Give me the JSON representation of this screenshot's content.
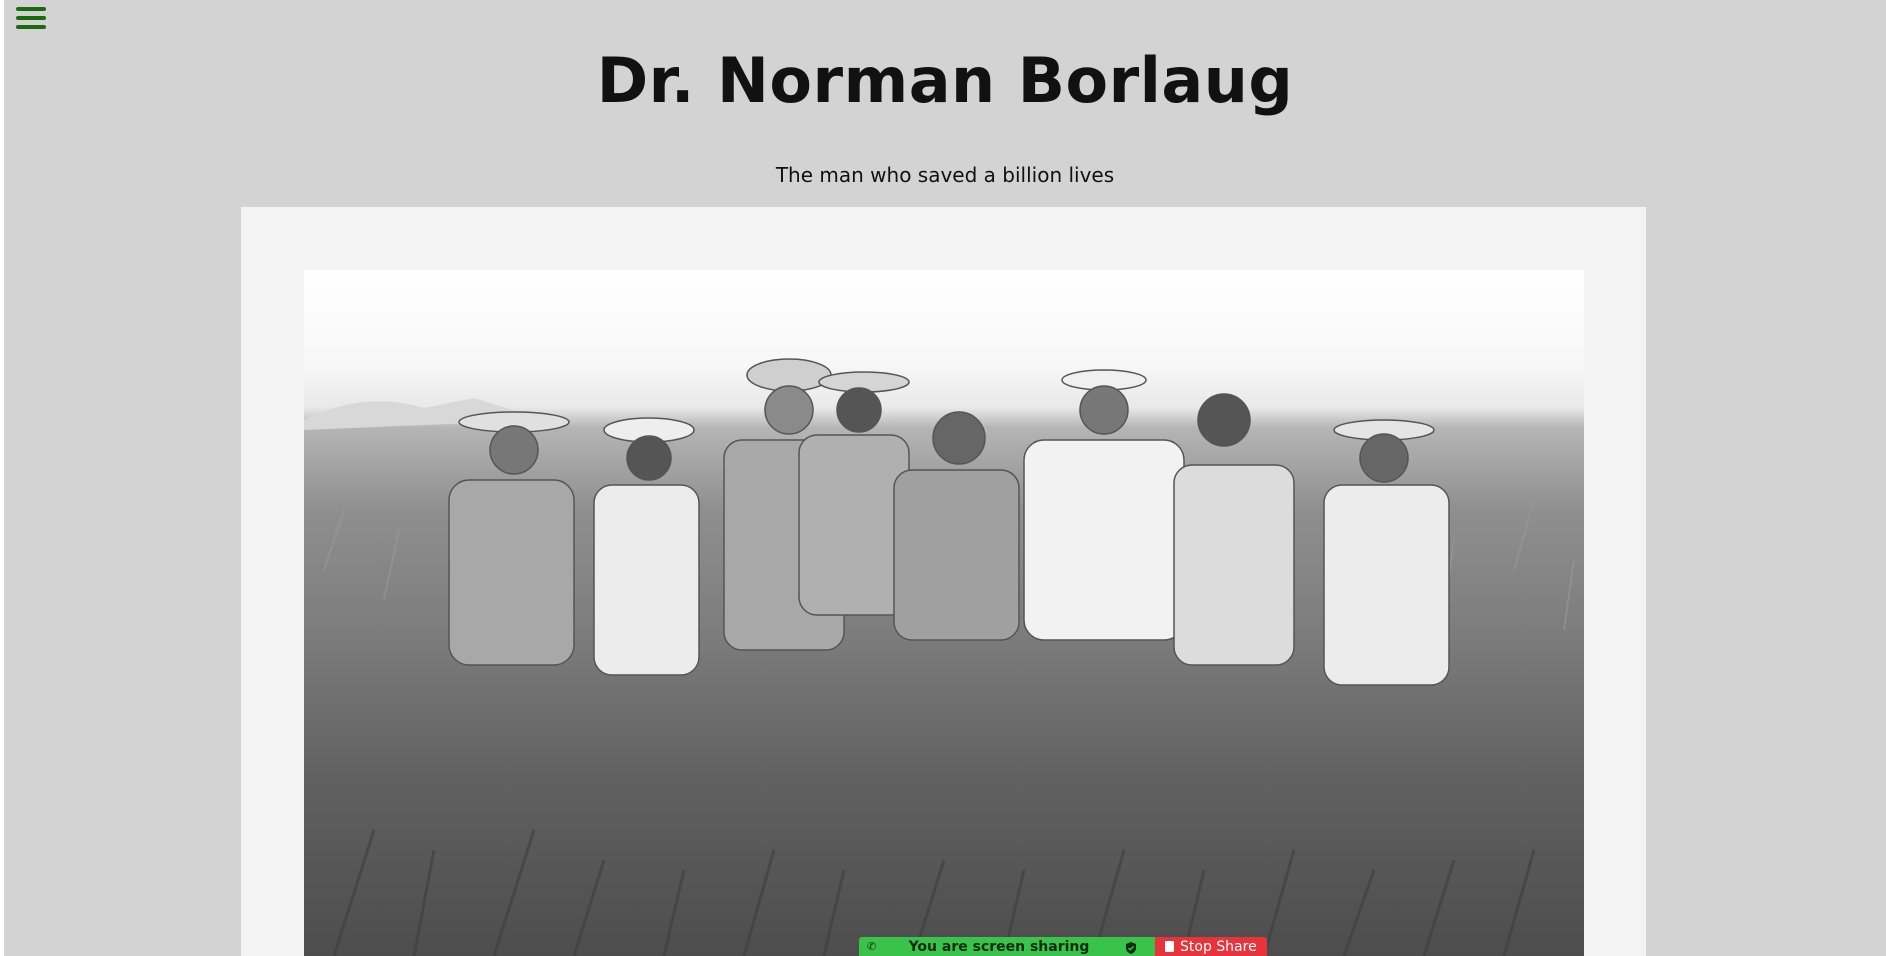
{
  "header": {
    "title": "Dr. Norman Borlaug",
    "subtitle": "The man who saved a billion lives"
  },
  "menu": {
    "icon": "hamburger-menu-icon",
    "color": "#1a6b0f"
  },
  "photo": {
    "description_icon": "wheat-field-photo"
  },
  "screen_share": {
    "status_text": "You are screen sharing",
    "stop_label": "Stop Share",
    "status_color": "#3ac34a",
    "stop_color": "#e8333b"
  }
}
